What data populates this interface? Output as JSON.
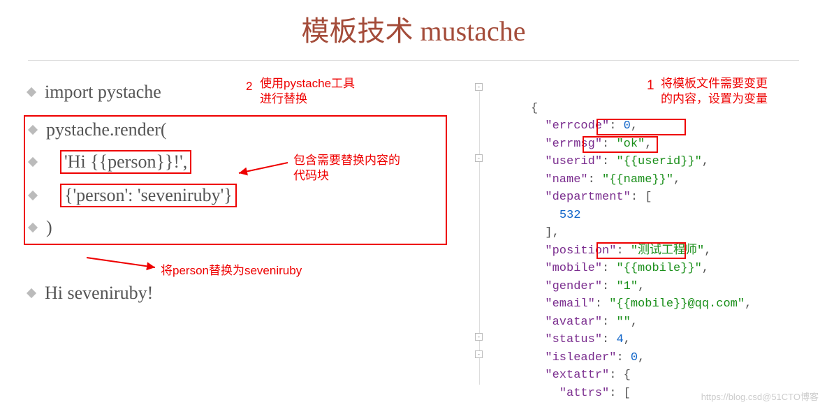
{
  "title": "模板技术 mustache",
  "left": {
    "l1": "import pystache",
    "l2": "pystache.render(",
    "l3": "'Hi {{person}}!',",
    "l4": "{'person': 'seveniruby'}",
    "l5": ")",
    "result": "Hi seveniruby!"
  },
  "ann": {
    "n2": "2",
    "t2a": "使用pystache工具",
    "t2b": "进行替换",
    "t3a": "包含需要替换内容的",
    "t3b": "代码块",
    "t4": "将person替换为seveniruby",
    "n1": "1",
    "t1a": "将模板文件需要变更",
    "t1b": "的内容，设置为变量"
  },
  "json": {
    "open": "{",
    "errcode_k": "\"errcode\"",
    "errcode_v": "0",
    "errmsg_k": "\"errmsg\"",
    "errmsg_v": "\"ok\"",
    "userid_k": "\"userid\"",
    "userid_v": "\"{{userid}}\"",
    "name_k": "\"name\"",
    "name_v": "\"{{name}}\"",
    "dept_k": "\"department\"",
    "dept_open": "[",
    "dept_val": "532",
    "dept_close": "]",
    "pos_k": "\"position\"",
    "pos_v": "\"测试工程师\"",
    "mobile_k": "\"mobile\"",
    "mobile_v": "\"{{mobile}}\"",
    "gender_k": "\"gender\"",
    "gender_v": "\"1\"",
    "email_k": "\"email\"",
    "email_v": "\"{{mobile}}@qq.com\"",
    "avatar_k": "\"avatar\"",
    "avatar_v": "\"\"",
    "status_k": "\"status\"",
    "status_v": "4",
    "isleader_k": "\"isleader\"",
    "isleader_v": "0",
    "extattr_k": "\"extattr\"",
    "extattr_open": "{",
    "attrs_k": "\"attrs\"",
    "attrs_open": "["
  },
  "watermark": "https://blog.csd@51CTO博客"
}
